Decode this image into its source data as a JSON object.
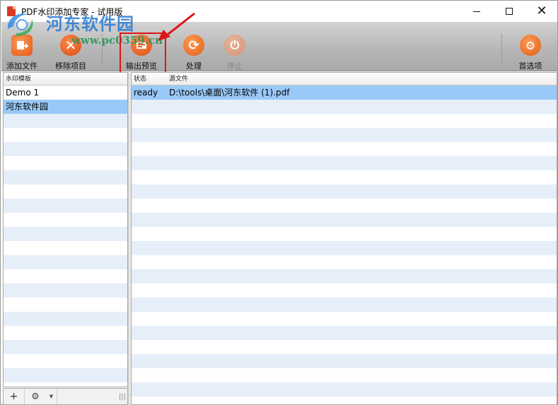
{
  "window": {
    "title": "PDF水印添加专家 - 试用版"
  },
  "watermark": {
    "site_name": "河东软件园",
    "site_url": "www.pc0359.cn"
  },
  "toolbar": {
    "buttons": [
      {
        "label": "添加文件",
        "icon": "add-file-icon",
        "enabled": true
      },
      {
        "label": "移除项目",
        "icon": "remove-x-icon",
        "enabled": true
      },
      {
        "label": "输出预览",
        "icon": "preview-icon",
        "enabled": true,
        "highlighted": true
      },
      {
        "label": "处理",
        "icon": "process-refresh-icon",
        "enabled": true
      },
      {
        "label": "停止",
        "icon": "stop-power-icon",
        "enabled": false
      },
      {
        "label": "首选项",
        "icon": "options-gear-icon",
        "enabled": true
      }
    ]
  },
  "left_panel": {
    "header": "水印模板",
    "items": [
      {
        "label": "Demo 1",
        "selected": false
      },
      {
        "label": "河东软件园",
        "selected": true
      }
    ],
    "footer": {
      "add_glyph": "+",
      "settings_glyph": "⚙",
      "dropdown_glyph": "▼",
      "grip_glyph": "|||"
    }
  },
  "file_grid": {
    "columns": [
      "状态",
      "源文件"
    ],
    "rows": [
      {
        "status": "ready",
        "source": "D:\\tools\\桌面\\河东软件 (1).pdf",
        "selected": true
      }
    ]
  },
  "colors": {
    "selection": "#99c9f7",
    "stripe": "#e6eef9",
    "highlight_box": "#e01414",
    "toolbar_icon": "#e2571a"
  }
}
